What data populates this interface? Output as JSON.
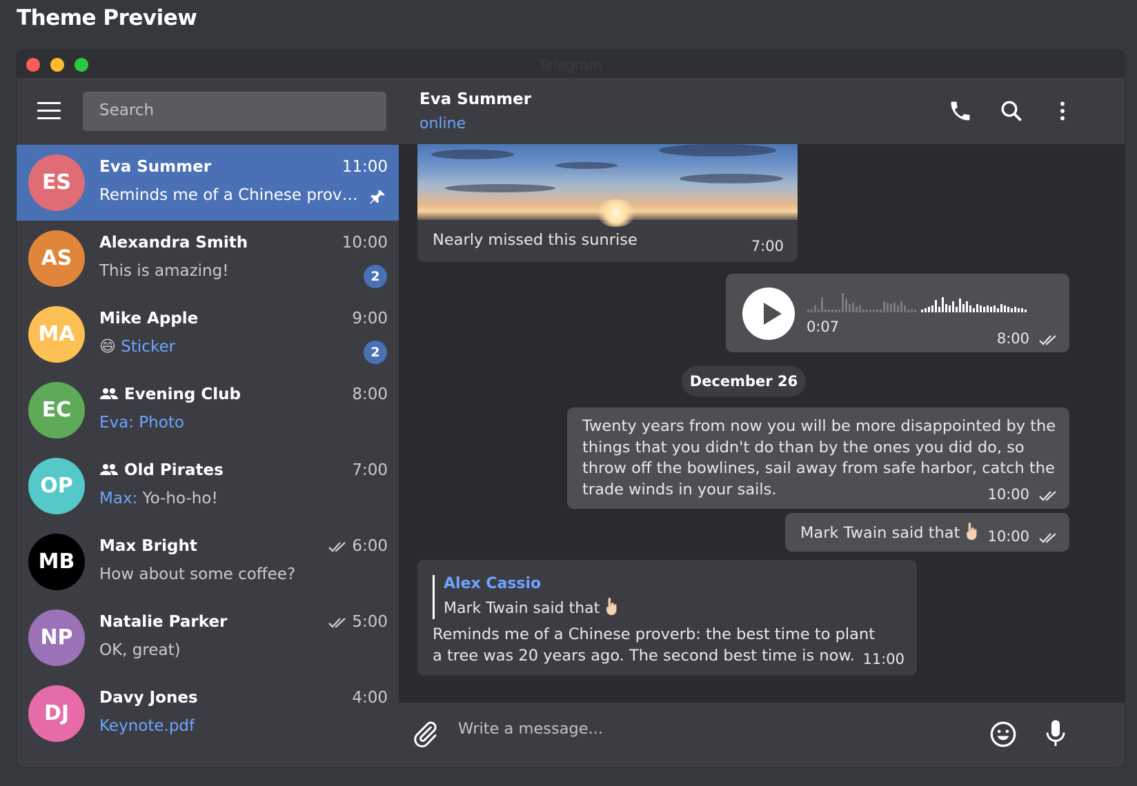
{
  "page_title": "Theme Preview",
  "window": {
    "title": "Telegram"
  },
  "sidebar": {
    "search_placeholder": "Search",
    "chats": [
      {
        "initials": "ES",
        "name": "Eva Summer",
        "time": "11:00",
        "preview": "Reminds me of a Chinese prover...",
        "avatar_color": "#e06c75",
        "pinned": true
      },
      {
        "initials": "AS",
        "name": "Alexandra Smith",
        "time": "10:00",
        "preview": "This is amazing!",
        "avatar_color": "#e08539",
        "unread": "2"
      },
      {
        "initials": "MA",
        "name": "Mike Apple",
        "time": "9:00",
        "preview_emoji": "😄",
        "preview": "Sticker",
        "avatar_color": "#fcc054",
        "unread": "2"
      },
      {
        "initials": "EC",
        "name": "Evening Club",
        "time": "8:00",
        "preview": "Eva: Photo",
        "avatar_color": "#5faa58",
        "group": true
      },
      {
        "initials": "OP",
        "name": "Old Pirates",
        "time": "7:00",
        "preview_sender": "Max:",
        "preview": "Yo-ho-ho!",
        "avatar_color": "#55c8ca",
        "group": true
      },
      {
        "initials": "MB",
        "name": "Max Bright",
        "time": "6:00",
        "preview": "How about some coffee?",
        "avatar_color": "#000000",
        "read": true
      },
      {
        "initials": "NP",
        "name": "Natalie Parker",
        "time": "5:00",
        "preview": "OK, great)",
        "avatar_color": "#9b72b7",
        "read": true
      },
      {
        "initials": "DJ",
        "name": "Davy Jones",
        "time": "4:00",
        "preview": "Keynote.pdf",
        "avatar_color": "#e66ba9"
      }
    ]
  },
  "chat": {
    "name": "Eva Summer",
    "status": "online",
    "messages": {
      "photo": {
        "caption": "Nearly missed this sunrise",
        "time": "7:00"
      },
      "voice": {
        "duration": "0:07",
        "time": "8:00"
      },
      "date_separator": "December 26",
      "long": {
        "text": "Twenty years from now you will be more disappointed by the things that you didn't do than by the ones you did do, so throw off the bowlines, sail away from safe harbor, catch the trade winds in your sails.",
        "time": "10:00"
      },
      "short": {
        "text": "Mark Twain said that",
        "time": "10:00"
      },
      "reply": {
        "author": "Alex Cassio",
        "quoted": "Mark Twain said that",
        "text": "Reminds me of a Chinese proverb: the best time to plant a tree was 20 years ago. The second best time is now.",
        "time": "11:00"
      }
    },
    "composer_placeholder": "Write a message..."
  },
  "icons": [
    "menu-icon",
    "pin-icon",
    "group-icon",
    "double-check-icon",
    "phone-icon",
    "search-icon",
    "more-icon",
    "play-icon",
    "paperclip-icon",
    "emoji-icon",
    "microphone-icon"
  ],
  "colors": {
    "accent": "#4a70b6",
    "link": "#6ea3ff",
    "sidebar_bg": "#3b3d42",
    "chat_bg": "#2a2b2e",
    "bubble_out": "#4d4f53"
  }
}
